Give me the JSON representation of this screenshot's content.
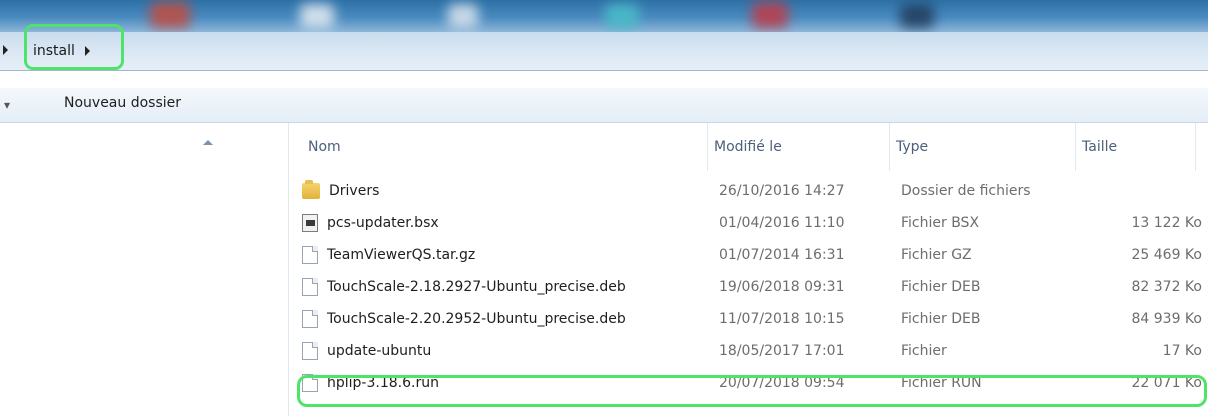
{
  "address_bar": {
    "crumbs": [
      "install"
    ]
  },
  "toolbar": {
    "new_folder_label": "Nouveau dossier"
  },
  "columns": {
    "name": "Nom",
    "modified": "Modifié le",
    "type": "Type",
    "size": "Taille"
  },
  "files": [
    {
      "name": "Drivers",
      "modified": "26/10/2016 14:27",
      "type": "Dossier de fichiers",
      "size": "",
      "icon": "folder-icon"
    },
    {
      "name": "pcs-updater.bsx",
      "modified": "01/04/2016 11:10",
      "type": "Fichier BSX",
      "size": "13 122 Ko",
      "icon": "bsx-file-icon"
    },
    {
      "name": "TeamViewerQS.tar.gz",
      "modified": "01/07/2014 16:31",
      "type": "Fichier GZ",
      "size": "25 469 Ko",
      "icon": "document-icon"
    },
    {
      "name": "TouchScale-2.18.2927-Ubuntu_precise.deb",
      "modified": "19/06/2018 09:31",
      "type": "Fichier DEB",
      "size": "82 372 Ko",
      "icon": "document-icon"
    },
    {
      "name": "TouchScale-2.20.2952-Ubuntu_precise.deb",
      "modified": "11/07/2018 10:15",
      "type": "Fichier DEB",
      "size": "84 939 Ko",
      "icon": "document-icon"
    },
    {
      "name": "update-ubuntu",
      "modified": "18/05/2017 17:01",
      "type": "Fichier",
      "size": "17 Ko",
      "icon": "document-icon"
    },
    {
      "name": "hplip-3.18.6.run",
      "modified": "20/07/2018 09:54",
      "type": "Fichier RUN",
      "size": "22 071 Ko",
      "icon": "document-icon"
    }
  ],
  "colors": {
    "highlight": "#4ee36a",
    "address_bar": "#d8e6f3",
    "header_text": "#4c607a",
    "secondary_text": "#6d6d6d"
  }
}
